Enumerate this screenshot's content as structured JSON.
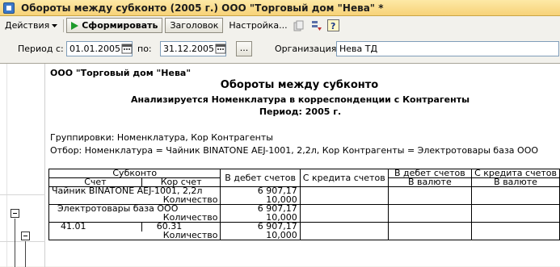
{
  "window": {
    "title": "Обороты между субконто (2005 г.) ООО \"Торговый дом \"Нева\" *"
  },
  "toolbar": {
    "actions_label": "Действия",
    "generate_label": "Сформировать",
    "header_label": "Заголовок",
    "settings_label": "Настройка..."
  },
  "period": {
    "from_label": "Период с:",
    "from_value": "01.01.2005",
    "to_label": "по:",
    "to_value": "31.12.2005",
    "dots": "...",
    "org_label": "Организация:",
    "org_value": "Нева ТД"
  },
  "report": {
    "org": "ООО \"Торговый дом \"Нева\"",
    "title": "Обороты между субконто",
    "subtitle": "Анализируется Номенклатура в корреспонденции с Контрагенты",
    "period": "Период: 2005 г.",
    "grouping": "Группировки: Номенклатура, Кор Контрагенты",
    "filter": "Отбор: Номенклатура = Чайник BINATONE  AEJ-1001,  2,2л, Кор Контрагенты = Электротовары база ООО",
    "headers": {
      "subkonto": "Субконто",
      "account": "Счет",
      "kor_account": "Кор счет",
      "debit": "В дебет счетов",
      "credit": "С кредита счетов",
      "debit2": "В дебет счетов",
      "credit2": "С кредита счетов",
      "currency1": "В валюте",
      "currency2": "В валюте"
    },
    "rows": [
      {
        "name": "Чайник BINATONE  AEJ-1001,  2,2л",
        "debit": "6 907,17",
        "qty_label": "Количество",
        "qty": "10,000"
      },
      {
        "name": "Электротовары база ООО",
        "debit": "6 907,17",
        "qty_label": "Количество",
        "qty": "10,000"
      },
      {
        "account": "41.01",
        "kor_account": "60.31",
        "debit": "6 907,17",
        "qty_label": "Количество",
        "qty": "10,000"
      }
    ]
  }
}
